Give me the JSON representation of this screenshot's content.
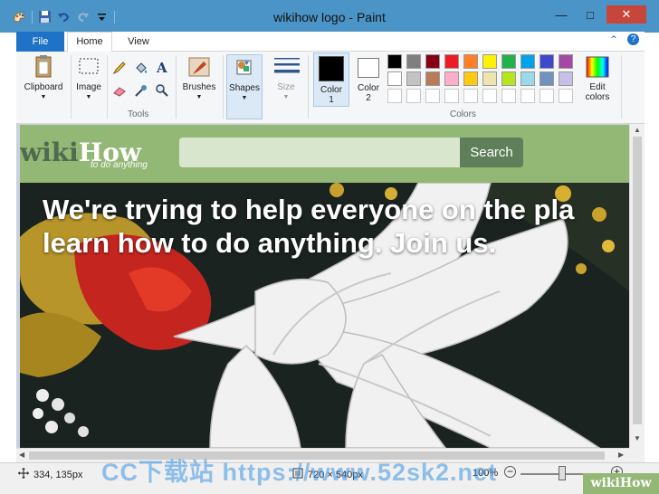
{
  "window": {
    "title": "wikihow logo - Paint"
  },
  "tabs": {
    "file": "File",
    "home": "Home",
    "view": "View"
  },
  "ribbon": {
    "clipboard": "Clipboard",
    "image": "Image",
    "tools": "Tools",
    "brushes": "Brushes",
    "shapes": "Shapes",
    "size": "Size",
    "color1": "Color\n1",
    "color2": "Color\n2",
    "colors": "Colors",
    "edit_colors": "Edit\ncolors",
    "palette_row1": [
      "#000000",
      "#7f7f7f",
      "#880015",
      "#ed1c24",
      "#ff7f27",
      "#fff200",
      "#22b14c",
      "#00a2e8",
      "#3f48cc",
      "#a349a4"
    ],
    "palette_row2": [
      "#ffffff",
      "#c3c3c3",
      "#b97a57",
      "#ffaec9",
      "#ffc90e",
      "#efe4b0",
      "#b5e61d",
      "#99d9ea",
      "#7092be",
      "#c8bfe7"
    ],
    "color1_value": "#000000",
    "color2_value": "#ffffff"
  },
  "picture": {
    "logo_wiki": "wiki",
    "logo_how": "How",
    "tagline": "to do anything",
    "search_button": "Search",
    "headline_line1": "We're trying to help everyone on the pla",
    "headline_line2": "learn how to do anything. Join us."
  },
  "status": {
    "cursor_pos": "334, 135px",
    "image_size": "720 × 540px",
    "zoom": "100%"
  },
  "watermark": {
    "text": "CC下载站 https://www.52sk2.net",
    "corner": "wikiHow"
  }
}
